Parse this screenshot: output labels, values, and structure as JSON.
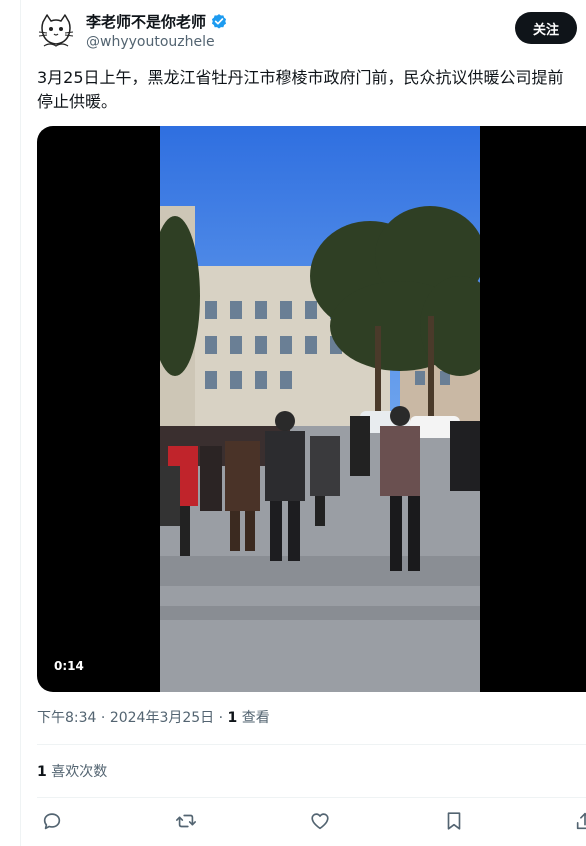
{
  "author": {
    "display_name": "李老师不是你老师",
    "handle": "@whyyoutouzhele",
    "verified": true,
    "avatar_icon": "cat-avatar-icon"
  },
  "follow_button": {
    "label": "关注"
  },
  "tweet": {
    "text_line1": "3月25日上午，黑龙江省牡丹江市穆棱市政府门前，民众抗议供暖公司提前",
    "text_line2": "停止供暖。"
  },
  "video": {
    "duration": "0:14"
  },
  "meta": {
    "time": "下午8:34",
    "separator": "·",
    "date": "2024年3月25日",
    "views_count": "1",
    "views_label": "查看"
  },
  "engagement": {
    "likes_count": "1",
    "likes_label": "喜欢次数"
  },
  "actions": [
    {
      "name": "reply-icon"
    },
    {
      "name": "retweet-icon"
    },
    {
      "name": "like-icon"
    },
    {
      "name": "bookmark-icon"
    },
    {
      "name": "share-icon"
    }
  ],
  "colors": {
    "text_primary": "#0f1419",
    "text_secondary": "#536471",
    "verified_blue": "#1d9bf0",
    "divider": "#eff3f4"
  }
}
